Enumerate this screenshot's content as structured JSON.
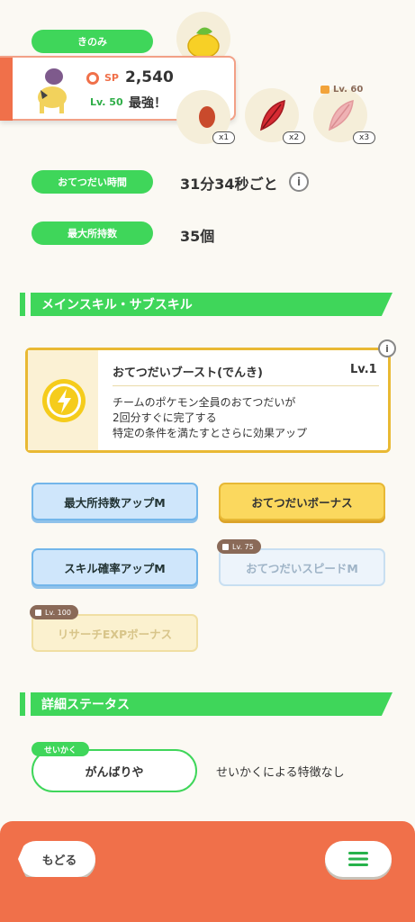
{
  "berry": {
    "label": "きのみ"
  },
  "pokemon": {
    "sp_label": "SP",
    "sp_value": "2,540",
    "level": "Lv. 50",
    "rank": "最強！"
  },
  "ingredients": [
    {
      "qty": "x1"
    },
    {
      "qty": "x2"
    },
    {
      "qty": "x3",
      "lock_level": "Lv. 60"
    }
  ],
  "stats": {
    "help_time_label": "おてつだい時間",
    "help_time_value": "31分34秒ごと",
    "info_icon": "i",
    "max_carry_label": "最大所持数",
    "max_carry_value": "35個"
  },
  "skills_section": {
    "title": "メインスキル・サブスキル",
    "main_skill": {
      "name": "おてつだいブースト(でんき)",
      "level": "Lv.1",
      "desc1": "チームのポケモン全員のおてつだいが",
      "desc2": "2回分すぐに完了する",
      "desc3": "特定の条件を満たすとさらに効果アップ"
    },
    "sub_skills": [
      {
        "label": "最大所持数アップM"
      },
      {
        "label": "おてつだいボーナス"
      },
      {
        "label": "スキル確率アップM"
      },
      {
        "label": "おてつだいスピードM",
        "lock_level": "Lv. 75"
      },
      {
        "label": "リサーチEXPボーナス",
        "lock_level": "Lv. 100"
      }
    ]
  },
  "detail_section": {
    "title": "詳細ステータス",
    "nature_tag": "せいかく",
    "nature_value": "がんばりや",
    "nature_effect": "せいかくによる特徴なし"
  },
  "footer": {
    "back_label": "もどる"
  },
  "colors": {
    "accent_green": "#3fd65a",
    "footer_orange": "#f0704a",
    "card_border": "#e9b933"
  }
}
